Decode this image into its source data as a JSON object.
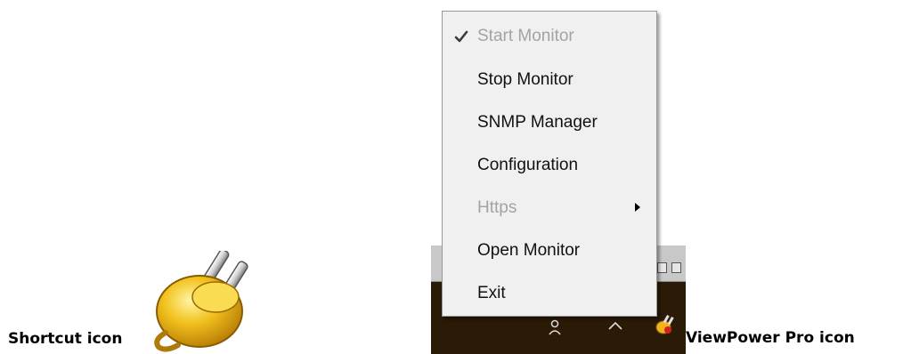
{
  "captions": {
    "shortcut": "Shortcut icon",
    "viewpower": "ViewPower Pro icon"
  },
  "context_menu": {
    "items": [
      {
        "label": "Start Monitor",
        "enabled": false,
        "checked": true
      },
      {
        "label": "Stop Monitor",
        "enabled": true
      },
      {
        "label": "SNMP Manager",
        "enabled": true
      },
      {
        "label": "Configuration",
        "enabled": true
      },
      {
        "label": "Https",
        "enabled": false,
        "submenu": true
      },
      {
        "label": "Open Monitor",
        "enabled": true
      },
      {
        "label": "Exit",
        "enabled": true
      }
    ]
  },
  "icons": {
    "shortcut": "plug-icon",
    "tray_people": "people-icon",
    "tray_chevron": "chevron-up-icon",
    "tray_app": "viewpower-tray-icon"
  },
  "colors": {
    "menu_bg": "#f0f0f0",
    "disabled_text": "#a3a3a3",
    "taskbar": "#2a1a06"
  }
}
